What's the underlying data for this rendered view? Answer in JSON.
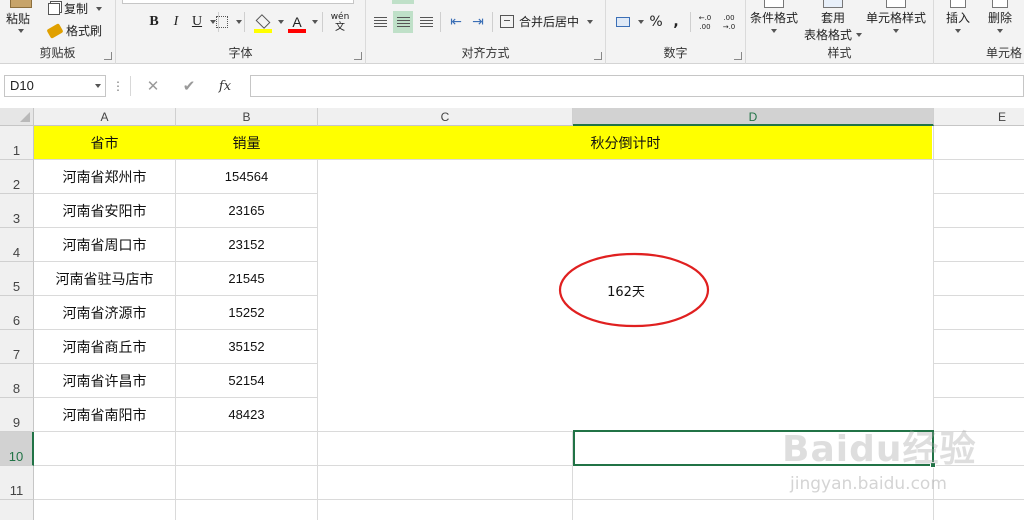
{
  "ribbon": {
    "clipboard": {
      "label": "剪贴板",
      "paste_label": "粘贴",
      "copy_label": "复制",
      "format_painter_label": "格式刷"
    },
    "font": {
      "label": "字体",
      "bold": "B",
      "italic": "I",
      "underline": "U",
      "font_color_glyph": "A",
      "phonetic_glyph": "wén",
      "phonetic_sub": "文"
    },
    "alignment": {
      "label": "对齐方式",
      "merge_center_label": "合并后居中"
    },
    "number": {
      "label": "数字",
      "percent": "%",
      "comma": ",",
      "inc_decimal": "←.0 .00",
      "dec_decimal": ".00 →.0"
    },
    "styles": {
      "label": "样式",
      "conditional_format_label": "条件格式",
      "table_format_label_1": "套用",
      "table_format_label_2": "表格格式",
      "cell_styles_label": "单元格样式"
    },
    "cells": {
      "label": "单元格",
      "insert_label": "插入",
      "delete_label": "删除"
    },
    "colors": {
      "fill_color": "#ffff00",
      "font_color": "#ff0000",
      "align_selected": "#bfe0c8"
    }
  },
  "formula_bar": {
    "name_box": "D10",
    "dots": "⋮",
    "cancel_glyph": "✕",
    "enter_glyph": "✔",
    "fx_label": "fx",
    "content": ""
  },
  "sheet": {
    "columns": [
      "A",
      "B",
      "C",
      "D",
      "E"
    ],
    "selected_column": "D",
    "rows": [
      "1",
      "2",
      "3",
      "4",
      "5",
      "6",
      "7",
      "8",
      "9",
      "10",
      "11"
    ],
    "selected_row": "10",
    "header": {
      "col_a": "省市",
      "col_b": "销量",
      "merged_cd": "秋分倒计时"
    },
    "data": [
      {
        "city": "河南省郑州市",
        "sales": "154564"
      },
      {
        "city": "河南省安阳市",
        "sales": "23165"
      },
      {
        "city": "河南省周口市",
        "sales": "23152"
      },
      {
        "city": "河南省驻马店市",
        "sales": "21545"
      },
      {
        "city": "河南省济源市",
        "sales": "15252"
      },
      {
        "city": "河南省商丘市",
        "sales": "35152"
      },
      {
        "city": "河南省许昌市",
        "sales": "52154"
      },
      {
        "city": "河南省南阳市",
        "sales": "48423"
      }
    ],
    "countdown_value": "162天",
    "header_fill": "#ffff00",
    "selection_color": "#217346",
    "callout_color": "#e02020"
  },
  "watermark": {
    "brand": "Baidu经验",
    "url": "jingyan.baidu.com"
  }
}
